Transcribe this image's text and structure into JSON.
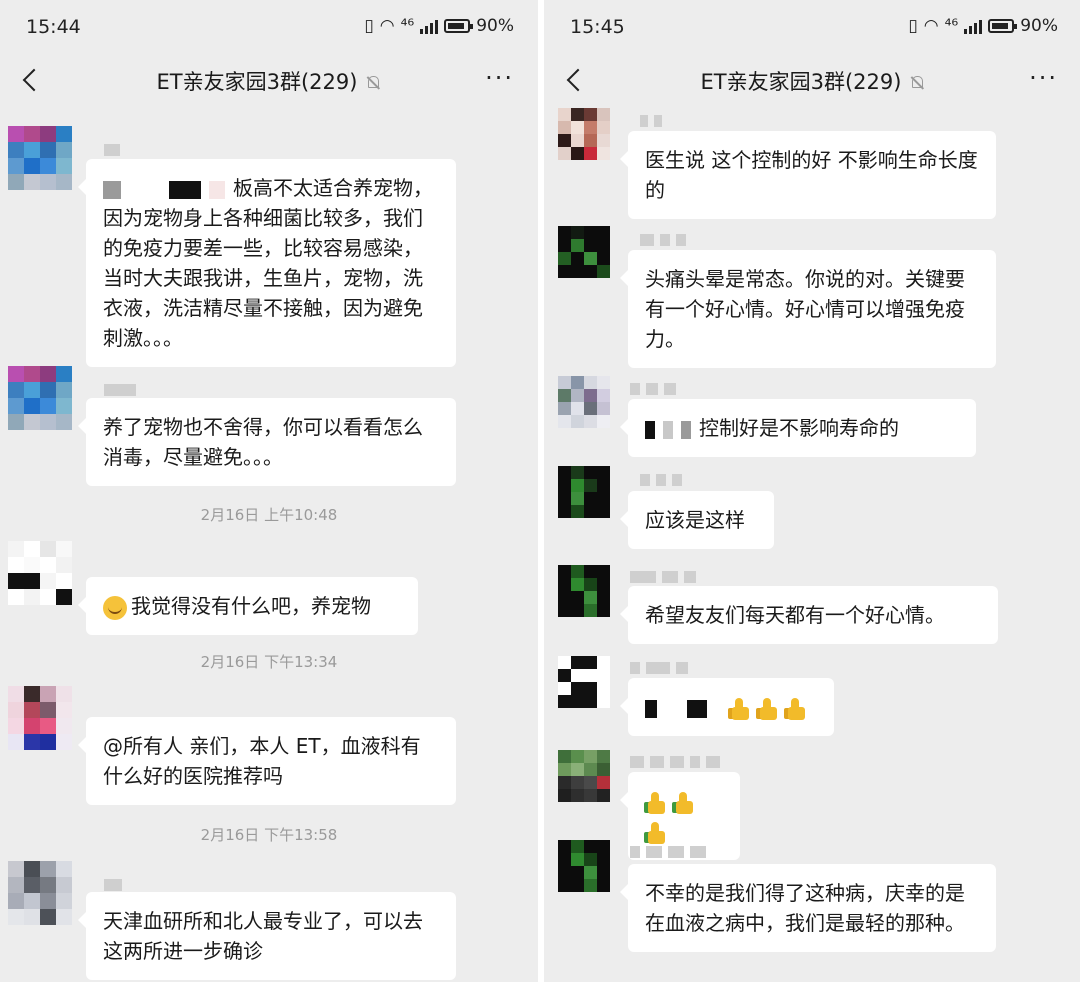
{
  "left": {
    "status": {
      "time": "15:44",
      "network": "⁴⁶",
      "battery": "90%"
    },
    "header": {
      "title": "ET亲友家园3群(229)"
    },
    "messages": [
      {
        "text": "板高不太适合养宠物，因为宠物身上各种细菌比较多，我们的免疫力要差一些，比较容易感染，当时大夫跟我讲，生鱼片，宠物，洗衣液，洗洁精尽量不接触，因为避免刺激。。。"
      },
      {
        "text": "养了宠物也不舍得，你可以看看怎么消毒，尽量避免。。。"
      },
      {
        "text": "我觉得没有什么吧，养宠物"
      },
      {
        "text": "@所有人 亲们，本人 ET，血液科有什么好的医院推荐吗"
      },
      {
        "text": "天津血研所和北人最专业了，可以去这两所进一步确诊"
      }
    ],
    "timestamps": [
      "2月16日 上午10:48",
      "2月16日 下午13:34",
      "2月16日 下午13:58"
    ]
  },
  "right": {
    "status": {
      "time": "15:45",
      "network": "⁴⁶",
      "battery": "90%"
    },
    "header": {
      "title": "ET亲友家园3群(229)"
    },
    "messages": [
      {
        "text": "医生说 这个控制的好 不影响生命长度的"
      },
      {
        "text": "头痛头晕是常态。你说的对。关键要有一个好心情。好心情可以增强免疫力。"
      },
      {
        "text": "控制好是不影响寿命的"
      },
      {
        "text": "应该是这样"
      },
      {
        "text": "希望友友们每天都有一个好心情。"
      },
      {
        "text": "不幸的是我们得了这种病，庆幸的是在血液之病中，我们是最轻的那种。"
      }
    ]
  },
  "icons": {
    "back": "back-arrow-icon",
    "mute": "mute-bell-icon",
    "more": "more-dots-icon",
    "emoji_laugh": "laugh-emoji-icon",
    "thumbs_up": "thumbs-up-icon"
  },
  "colors": {
    "background": "#ededed",
    "bubble": "#ffffff",
    "timestamp": "#9a9a9a"
  }
}
